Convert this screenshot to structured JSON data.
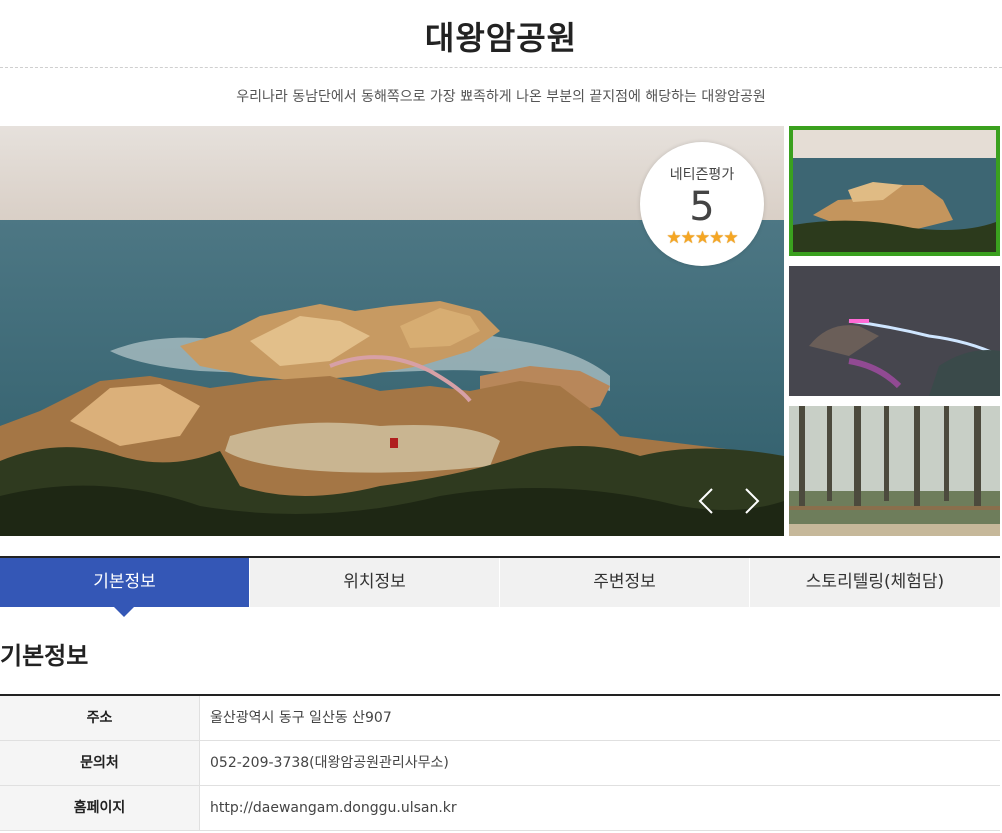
{
  "header": {
    "title": "대왕암공원",
    "subtitle": "우리나라 동남단에서 동해쪽으로 가장 뾰족하게 나온 부분의 끝지점에 해당하는 대왕암공원"
  },
  "rating": {
    "label": "네티즌평가",
    "score": "5",
    "stars": 5,
    "stars_text": "★★★★★"
  },
  "tabs": [
    {
      "label": "기본정보"
    },
    {
      "label": "위치정보"
    },
    {
      "label": "주변정보"
    },
    {
      "label": "스토리텔링(체험담)"
    }
  ],
  "section": {
    "title": "기본정보"
  },
  "info": [
    {
      "label": "주소",
      "value": "울산광역시 동구 일산동 산907"
    },
    {
      "label": "문의처",
      "value": "052-209-3738(대왕암공원관리사무소)"
    },
    {
      "label": "홈페이지",
      "value": "http://daewangam.donggu.ulsan.kr"
    }
  ],
  "colors": {
    "accent": "#3457b6",
    "thumb_selected_border": "#3aa01e",
    "star": "#f5a623"
  }
}
